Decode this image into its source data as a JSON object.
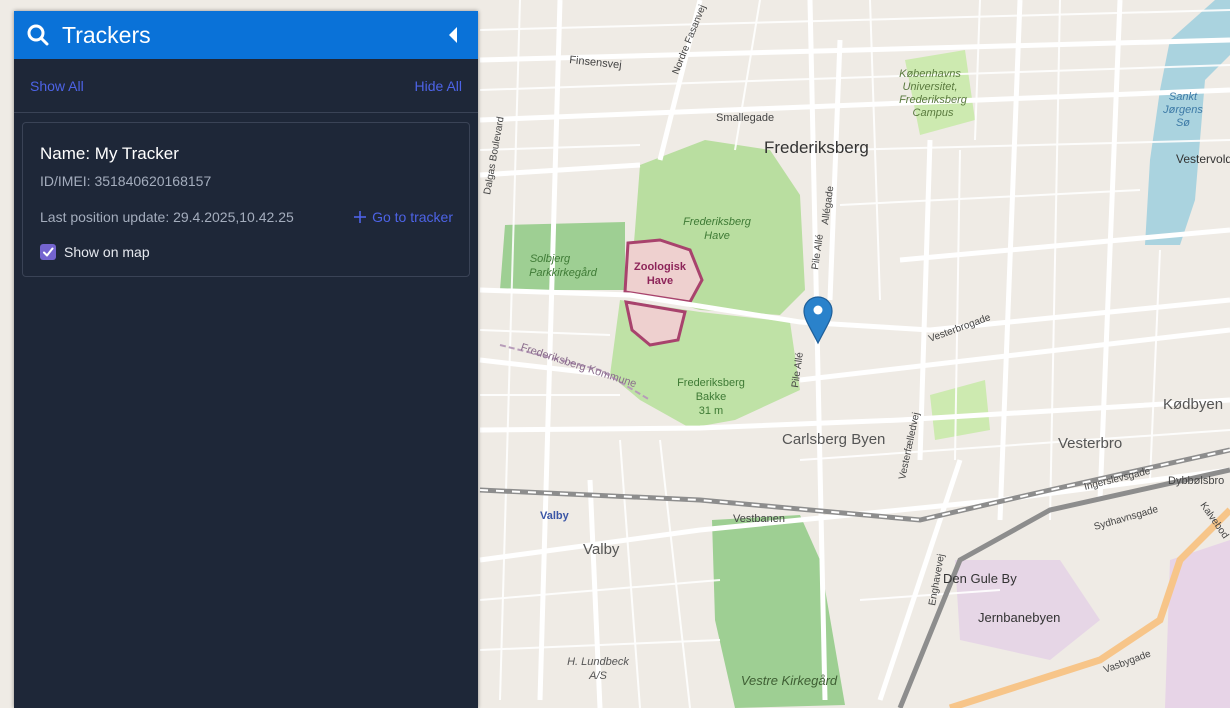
{
  "panel": {
    "title": "Trackers",
    "show_all": "Show All",
    "hide_all": "Hide All"
  },
  "tracker": {
    "name": "Name: My Tracker",
    "id_imei": "ID/IMEI: 351840620168157",
    "last_update": "Last position update: 29.4.2025,10.42.25",
    "goto_label": "Go to tracker",
    "show_on_map_label": "Show on map",
    "show_on_map_checked": true
  },
  "map": {
    "labels": {
      "frederiksberg": "Frederiksberg",
      "kbh_uni_1": "Københavns",
      "kbh_uni_2": "Universitet,",
      "kbh_uni_3": "Frederiksberg",
      "kbh_uni_4": "Campus",
      "smallegade": "Smallegade",
      "finsensvej": "Finsensvej",
      "dalgas_boulevard": "Dalgas Boulevard",
      "nordre_fasanvej": "Nordre Fasanvej",
      "frb_have_1": "Frederiksberg",
      "frb_have_2": "Have",
      "zoo_1": "Zoologisk",
      "zoo_2": "Have",
      "solbjerg_1": "Solbjerg",
      "solbjerg_2": "Parkkirkegård",
      "frb_kommune": "Frederiksberg Kommune",
      "frb_bakke_1": "Frederiksberg",
      "frb_bakke_2": "Bakke",
      "frb_bakke_3": "31 m",
      "pile_alle": "Pile Allé",
      "allegade": "Allégade",
      "vesterbrogade": "Vesterbrogade",
      "vesterfaelledvej": "Vesterfælledvej",
      "carlsberg_byen": "Carlsberg Byen",
      "vesterbro": "Vesterbro",
      "kodbyen": "Kødbyen",
      "ingerslevsgade": "Ingerslevsgade",
      "dybbolsbro": "Dybbølsbro",
      "sydhavnsgade": "Sydhavnsgade",
      "vestbanen": "Vestbanen",
      "valby_station": "Valby",
      "valby": "Valby",
      "den_gule_by": "Den Gule By",
      "jernbanebyen": "Jernbanebyen",
      "enghavevej": "Enghavevej",
      "vasbygade": "Vasbygade",
      "h_lundbeck_1": "H. Lundbeck",
      "h_lundbeck_2": "A/S",
      "vestre_kirkegard": "Vestre Kirkegård",
      "sankt_jorgens_1": "Sankt",
      "sankt_jorgens_2": "Jørgens",
      "sankt_jorgens_3": "Sø",
      "vestervold": "Vestervold",
      "kalvebod": "Kalvebod"
    }
  },
  "colors": {
    "header_bg": "#0a72d8",
    "panel_bg": "#1e2738",
    "link": "#4d63e6",
    "checkbox": "#7464cf",
    "marker": "#2a82cb"
  },
  "icons": {
    "header_search": "search-icon",
    "collapse": "caret-left-icon",
    "goto": "plus-icon",
    "marker": "map-marker-icon"
  }
}
